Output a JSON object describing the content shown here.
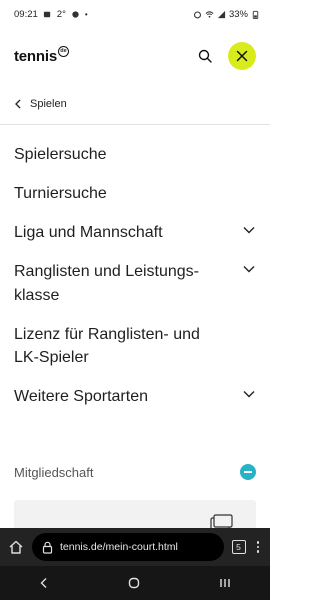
{
  "status_bar": {
    "time": "09:21",
    "temp": "2°",
    "battery": "33%"
  },
  "header": {
    "logo_text": "tennis",
    "logo_badge": "de"
  },
  "back": {
    "label": "Spielen"
  },
  "menu": [
    {
      "label": "Spielersuche",
      "expandable": false
    },
    {
      "label": "Turniersuche",
      "expandable": false
    },
    {
      "label": "Liga und Mannschaft",
      "expandable": true
    },
    {
      "label": "Ranglisten und Leistungs-klasse",
      "line1": "Ranglisten und Leistungs-",
      "line2": "klasse",
      "expandable": true
    },
    {
      "label": "Lizenz für Ranglisten- und LK-Spieler",
      "line1": "Lizenz für Ranglisten- und",
      "line2": "LK-Spieler",
      "expandable": false
    },
    {
      "label": "Weitere Sportarten",
      "expandable": true
    }
  ],
  "membership": {
    "label": "Mitgliedschaft"
  },
  "browser": {
    "url": "tennis.de/mein-court.html",
    "tab_count": "5"
  },
  "colors": {
    "accent": "#d8ec1d",
    "toggle": "#27b2c8",
    "browser_bar": "#232323"
  }
}
